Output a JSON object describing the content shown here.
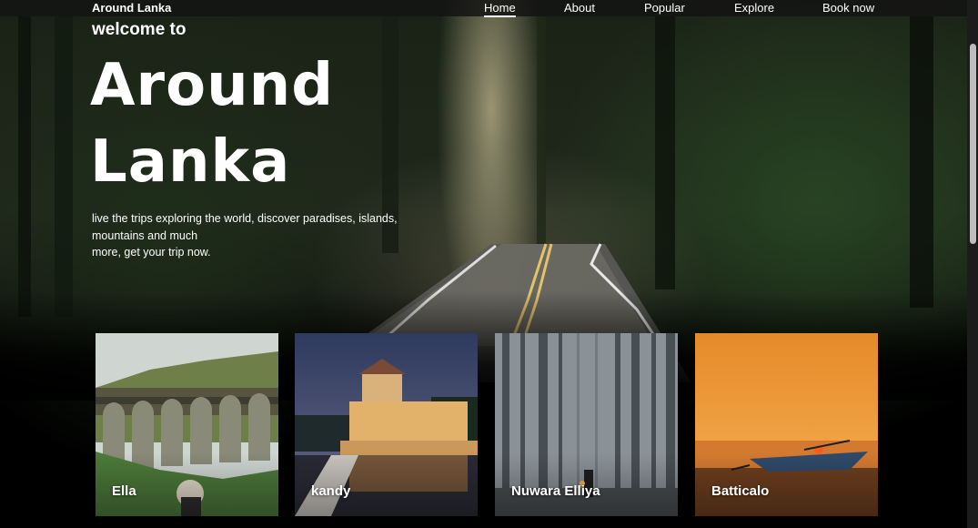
{
  "navbar": {
    "brand": "Around Lanka",
    "links": [
      {
        "label": "Home",
        "active": true
      },
      {
        "label": "About",
        "active": false
      },
      {
        "label": "Popular",
        "active": false
      },
      {
        "label": "Explore",
        "active": false
      },
      {
        "label": "Book now",
        "active": false
      }
    ]
  },
  "hero": {
    "welcome": "welcome to",
    "title_line1": "Around",
    "title_line2": "Lanka",
    "subtitle_line1": "live the trips exploring the world, discover paradises, islands,",
    "subtitle_line2": "mountains and much",
    "subtitle_line3": "more, get your trip now."
  },
  "cards": [
    {
      "label": "Ella",
      "image": "bridge-photo"
    },
    {
      "label": "kandy",
      "image": "temple-photo"
    },
    {
      "label": "Nuwara Elliya",
      "image": "misty-forest-photo"
    },
    {
      "label": "Batticalo",
      "image": "sunset-beach-photo"
    }
  ]
}
